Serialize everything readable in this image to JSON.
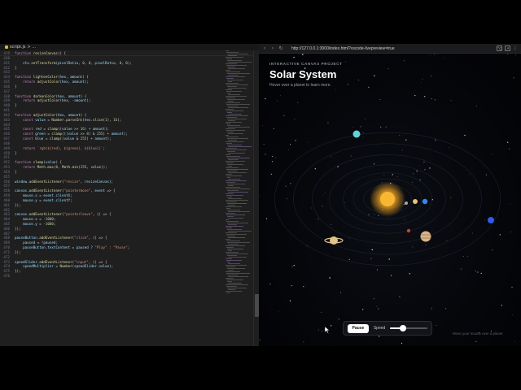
{
  "editor": {
    "tab_label": "script.js",
    "tab_crumb": "> ...",
    "sticky": {
      "ln": "419",
      "text": "function resizeCanvas() {"
    },
    "lines": [
      {
        "ln": "430",
        "html": ""
      },
      {
        "ln": "431",
        "html": "    <span class=\"vr\">ctx</span>.<span class=\"fn\">setTransform</span>(<span class=\"vr\">pixelRatio</span>, <span class=\"nm\">0</span>, <span class=\"nm\">0</span>, <span class=\"vr\">pixelRatio</span>, <span class=\"nm\">0</span>, <span class=\"nm\">0</span>);"
      },
      {
        "ln": "432",
        "html": "}"
      },
      {
        "ln": "433",
        "html": ""
      },
      {
        "ln": "434",
        "html": "<span class=\"kw\">function</span> <span class=\"fn\">lightenColor</span>(<span class=\"vr\">hex</span>, <span class=\"vr\">amount</span>) {"
      },
      {
        "ln": "435",
        "html": "    <span class=\"kw\">return</span> <span class=\"fn\">adjustColor</span>(<span class=\"vr\">hex</span>, <span class=\"vr\">amount</span>);"
      },
      {
        "ln": "436",
        "html": "}"
      },
      {
        "ln": "437",
        "html": ""
      },
      {
        "ln": "438",
        "html": "<span class=\"kw\">function</span> <span class=\"fn\">darkenColor</span>(<span class=\"vr\">hex</span>, <span class=\"vr\">amount</span>) {"
      },
      {
        "ln": "439",
        "html": "    <span class=\"kw\">return</span> <span class=\"fn\">adjustColor</span>(<span class=\"vr\">hex</span>, -<span class=\"vr\">amount</span>);"
      },
      {
        "ln": "440",
        "html": "}"
      },
      {
        "ln": "441",
        "html": ""
      },
      {
        "ln": "442",
        "html": "<span class=\"kw\">function</span> <span class=\"fn\">adjustColor</span>(<span class=\"vr\">hex</span>, <span class=\"vr\">amount</span>) {"
      },
      {
        "ln": "443",
        "html": "    <span class=\"kw\">const</span> <span class=\"vr\">value</span> = <span class=\"fn\">Number</span>.<span class=\"fn\">parseInt</span>(<span class=\"vr\">hex</span>.<span class=\"fn\">slice</span>(<span class=\"nm\">1</span>), <span class=\"nm\">16</span>);"
      },
      {
        "ln": "444",
        "html": ""
      },
      {
        "ln": "445",
        "html": "    <span class=\"kw\">const</span> <span class=\"vr\">red</span> = <span class=\"fn\">clamp</span>((<span class=\"vr\">value</span> &gt;&gt; <span class=\"nm\">16</span>) + <span class=\"vr\">amount</span>);"
      },
      {
        "ln": "446",
        "html": "    <span class=\"kw\">const</span> <span class=\"vr\">green</span> = <span class=\"fn\">clamp</span>(((<span class=\"vr\">value</span> &gt;&gt; <span class=\"nm\">8</span>) &amp; <span class=\"nm\">255</span>) + <span class=\"vr\">amount</span>);"
      },
      {
        "ln": "447",
        "html": "    <span class=\"kw\">const</span> <span class=\"vr\">blue</span> = <span class=\"fn\">clamp</span>((<span class=\"vr\">value</span> &amp; <span class=\"nm\">255</span>) + <span class=\"vr\">amount</span>);"
      },
      {
        "ln": "448",
        "html": ""
      },
      {
        "ln": "449",
        "html": "    <span class=\"kw\">return</span> <span class=\"st\">`rgb(${red}, ${green}, ${blue})`</span>;"
      },
      {
        "ln": "450",
        "html": "}"
      },
      {
        "ln": "451",
        "html": ""
      },
      {
        "ln": "452",
        "html": "<span class=\"kw\">function</span> <span class=\"fn\">clamp</span>(<span class=\"vr\">value</span>) {"
      },
      {
        "ln": "453",
        "html": "    <span class=\"kw\">return</span> <span class=\"fn\">Math</span>.<span class=\"fn\">max</span>(<span class=\"nm\">0</span>, <span class=\"fn\">Math</span>.<span class=\"fn\">min</span>(<span class=\"nm\">255</span>, <span class=\"vr\">value</span>));"
      },
      {
        "ln": "454",
        "html": "}"
      },
      {
        "ln": "455",
        "html": ""
      },
      {
        "ln": "456",
        "html": "<span class=\"vr\">window</span>.<span class=\"fn\">addEventListener</span>(<span class=\"st\">\"resize\"</span>, <span class=\"vr\">resizeCanvas</span>);"
      },
      {
        "ln": "457",
        "html": ""
      },
      {
        "ln": "458",
        "html": "<span class=\"vr\">canvas</span>.<span class=\"fn\">addEventListener</span>(<span class=\"st\">\"pointermove\"</span>, <span class=\"vr\">event</span> =&gt; {"
      },
      {
        "ln": "459",
        "html": "    <span class=\"vr\">mouse</span>.<span class=\"vr\">x</span> = <span class=\"vr\">event</span>.<span class=\"vr\">clientX</span>;"
      },
      {
        "ln": "460",
        "html": "    <span class=\"vr\">mouse</span>.<span class=\"vr\">y</span> = <span class=\"vr\">event</span>.<span class=\"vr\">clientY</span>;"
      },
      {
        "ln": "461",
        "html": "});"
      },
      {
        "ln": "462",
        "html": ""
      },
      {
        "ln": "463",
        "html": "<span class=\"vr\">canvas</span>.<span class=\"fn\">addEventListener</span>(<span class=\"st\">\"pointerleave\"</span>, () =&gt; {"
      },
      {
        "ln": "464",
        "html": "    <span class=\"vr\">mouse</span>.<span class=\"vr\">x</span> = -<span class=\"nm\">1000</span>;"
      },
      {
        "ln": "465",
        "html": "    <span class=\"vr\">mouse</span>.<span class=\"vr\">y</span> = -<span class=\"nm\">1000</span>;"
      },
      {
        "ln": "466",
        "html": "});"
      },
      {
        "ln": "467",
        "html": ""
      },
      {
        "ln": "468",
        "html": "<span class=\"vr\">pauseButton</span>.<span class=\"fn\">addEventListener</span>(<span class=\"st\">\"click\"</span>, () =&gt; {"
      },
      {
        "ln": "469",
        "html": "    <span class=\"vr\">paused</span> = !<span class=\"vr\">paused</span>;"
      },
      {
        "ln": "470",
        "html": "    <span class=\"vr\">pauseButton</span>.<span class=\"vr\">textContent</span> = <span class=\"vr\">paused</span> ? <span class=\"st\">\"Play\"</span> : <span class=\"st\">\"Pause\"</span>;"
      },
      {
        "ln": "471",
        "html": "});"
      },
      {
        "ln": "472",
        "html": ""
      },
      {
        "ln": "473",
        "html": "<span class=\"vr\">speedSlider</span>.<span class=\"fn\">addEventListener</span>(<span class=\"st\">\"input\"</span>, () =&gt; {"
      },
      {
        "ln": "474",
        "html": "    <span class=\"vr\">speedMultiplier</span> = <span class=\"fn\">Number</span>(<span class=\"vr\">speedSlider</span>.<span class=\"vr\">value</span>);"
      },
      {
        "ln": "475",
        "html": "});"
      },
      {
        "ln": "476",
        "html": ""
      }
    ]
  },
  "browser": {
    "url": "http://127.0.0.1:3000/index.html?vscode-livepreview=true",
    "eyebrow": "INTERACTIVE CANVAS PROJECT",
    "title": "Solar System",
    "subtitle": "Hover over a planet to learn more.",
    "pause_label": "Pause",
    "speed_label": "Speed",
    "speed_fraction": 0.35,
    "hint": "Move your mouse over a planet"
  },
  "colors": {
    "sun": "#f5a623",
    "mercury": "#a8a8a8",
    "venus": "#e8c27a",
    "earth": "#3b82f6",
    "mars": "#c2452f",
    "jupiter": "#d9b48a",
    "saturn": "#e0c48a",
    "uranus": "#5fd3d8",
    "neptune": "#2f5bea"
  }
}
